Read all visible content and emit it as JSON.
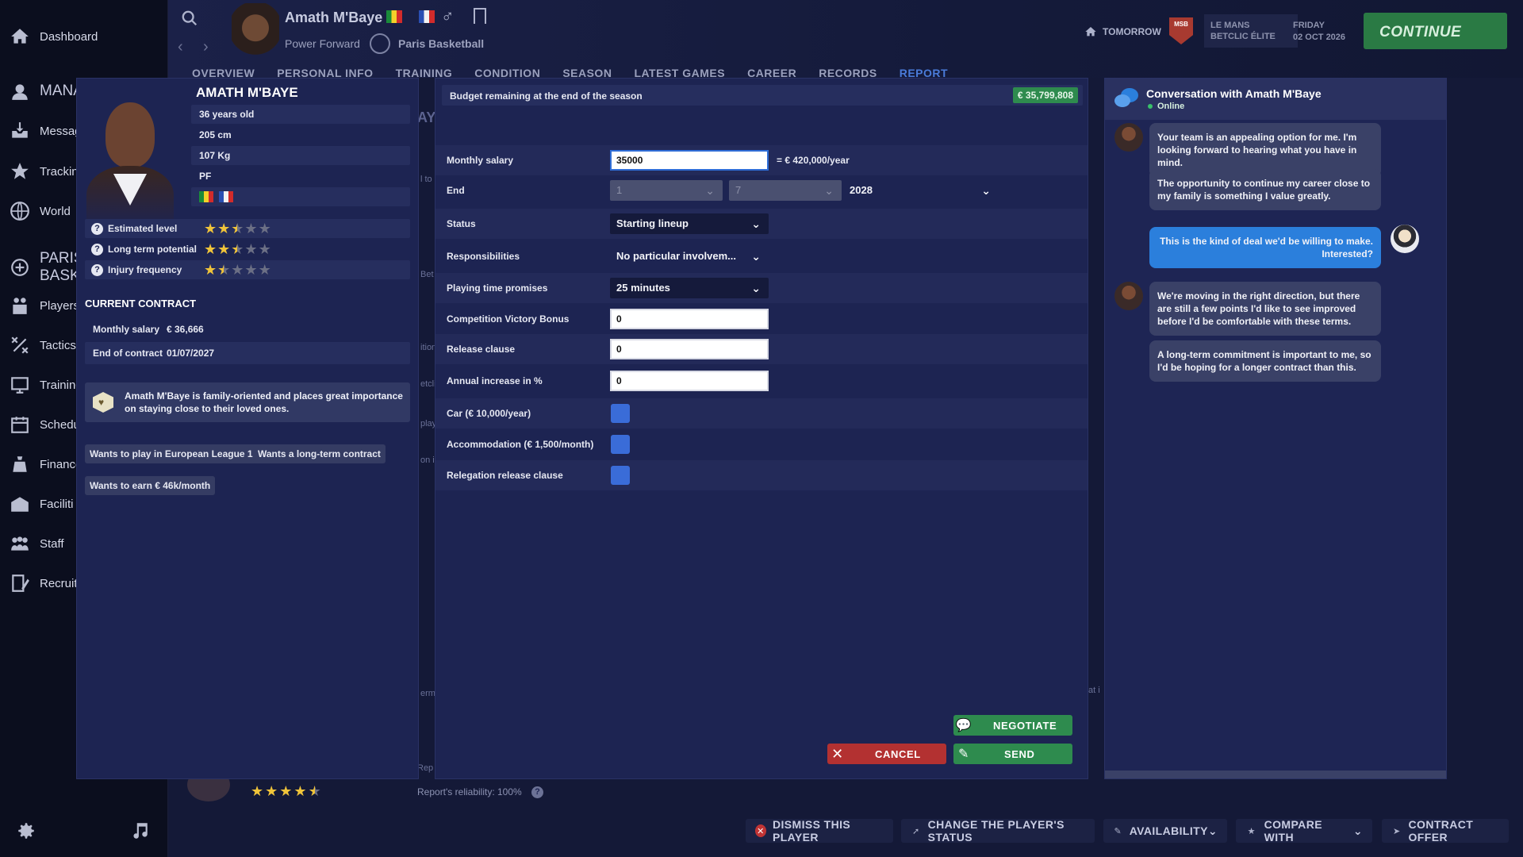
{
  "nav": {
    "items": [
      {
        "label": "Dashboard",
        "icon": "home-icon"
      },
      {
        "label": "MANA",
        "icon": "manager-icon"
      },
      {
        "label": "Messag",
        "icon": "inbox-icon"
      },
      {
        "label": "Trackin",
        "icon": "star-icon"
      },
      {
        "label": "World",
        "icon": "globe-icon"
      },
      {
        "label": "PARIS BASKI",
        "icon": "club-badge-icon"
      },
      {
        "label": "Players",
        "icon": "players-icon"
      },
      {
        "label": "Tactics",
        "icon": "tactics-icon"
      },
      {
        "label": "Training",
        "icon": "training-icon"
      },
      {
        "label": "Schedu",
        "icon": "calendar-icon"
      },
      {
        "label": "Finance",
        "icon": "finance-icon"
      },
      {
        "label": "Faciliti",
        "icon": "facilities-icon"
      },
      {
        "label": "Staff",
        "icon": "staff-icon"
      },
      {
        "label": "Recruit",
        "icon": "recruit-icon"
      }
    ]
  },
  "header": {
    "player_name": "Amath M'Baye",
    "position": "Power Forward",
    "club": "Paris Basketball",
    "next_match_label": "TOMORROW",
    "opponent_line1": "LE MANS",
    "opponent_line2": "BETCLIC ÉLITE",
    "opponent_abbr": "MSB",
    "date_line1": "FRIDAY",
    "date_line2": "02 OCT 2026",
    "continue_label": "CONTINUE",
    "tabs": [
      "OVERVIEW",
      "PERSONAL INFO",
      "TRAINING",
      "CONDITION",
      "SEASON",
      "LATEST GAMES",
      "CAREER",
      "RECORDS",
      "REPORT"
    ],
    "active_tab": "REPORT"
  },
  "player_card": {
    "name": "AMATH M'BAYE",
    "age": "36 years old",
    "height": "205 cm",
    "weight": "107 Kg",
    "position_abbr": "PF",
    "ratings": [
      {
        "label": "Estimated level",
        "stars": 2.5
      },
      {
        "label": "Long term potential",
        "stars": 2.5
      },
      {
        "label": "Injury frequency",
        "stars": 1.5
      }
    ],
    "contract_title": "CURRENT CONTRACT",
    "contract": [
      {
        "key": "Monthly salary",
        "value": "€ 36,666"
      },
      {
        "key": "End of contract",
        "value": "01/07/2027"
      }
    ],
    "trait_text": "Amath M'Baye is family-oriented and places great importance on staying close to their loved ones.",
    "tags": [
      "Wants to play in European League 1",
      "Wants a long-term contract",
      "Wants to earn € 46k/month"
    ]
  },
  "offer_form": {
    "budget_label": "Budget remaining at the end of the season",
    "budget_value": "€ 35,799,808",
    "monthly_salary_label": "Monthly salary",
    "monthly_salary_value": "35000",
    "monthly_salary_annual": "= € 420,000/year",
    "end_label": "End",
    "end_day": "1",
    "end_month": "7",
    "end_year": "2028",
    "status_label": "Status",
    "status_value": "Starting lineup",
    "responsibilities_label": "Responsibilities",
    "responsibilities_value": "No particular involvem...",
    "playing_time_label": "Playing time promises",
    "playing_time_value": "25 minutes",
    "victory_bonus_label": "Competition Victory Bonus",
    "victory_bonus_value": "0",
    "release_clause_label": "Release clause",
    "release_clause_value": "0",
    "annual_increase_label": "Annual increase in %",
    "annual_increase_value": "0",
    "car_label": "Car (€ 10,000/year)",
    "accommodation_label": "Accommodation (€ 1,500/month)",
    "relegation_label": "Relegation release clause",
    "negotiate_label": "NEGOTIATE",
    "cancel_label": "CANCEL",
    "send_label": "SEND"
  },
  "chat": {
    "title": "Conversation with Amath M'Baye",
    "status": "Online",
    "messages": [
      {
        "from": "player",
        "text": "Your team is an appealing option for me. I'm looking forward to hearing what you have in mind."
      },
      {
        "from": "player",
        "text": "The opportunity to continue my career close to my family is something I value greatly."
      },
      {
        "from": "me",
        "text": "This is the kind of deal we'd be willing to make. Interested?"
      },
      {
        "from": "player",
        "text": "We're moving in the right direction, but there are still a few points I'd like to see improved before I'd be comfortable with these terms."
      },
      {
        "from": "player",
        "text": "A long-term commitment is important to me, so I'd be hoping for a longer contract than this."
      }
    ]
  },
  "under": {
    "reliability": "Report's reliability: 100%",
    "fragments": [
      "AY",
      "l to",
      "Bet",
      "etcli",
      "ition",
      "play",
      "on i",
      "erm",
      "Rep",
      "at i"
    ]
  },
  "bottom_actions": {
    "dismiss": "DISMISS THIS PLAYER",
    "change_status": "CHANGE THE PLAYER'S STATUS",
    "availability": "AVAILABILITY",
    "compare": "COMPARE WITH",
    "contract_offer": "CONTRACT OFFER"
  },
  "colors": {
    "accent_green": "#2e8b4e",
    "accent_blue": "#2b7fdc",
    "cancel_red": "#c13434",
    "star_gold": "#f0c43a"
  }
}
